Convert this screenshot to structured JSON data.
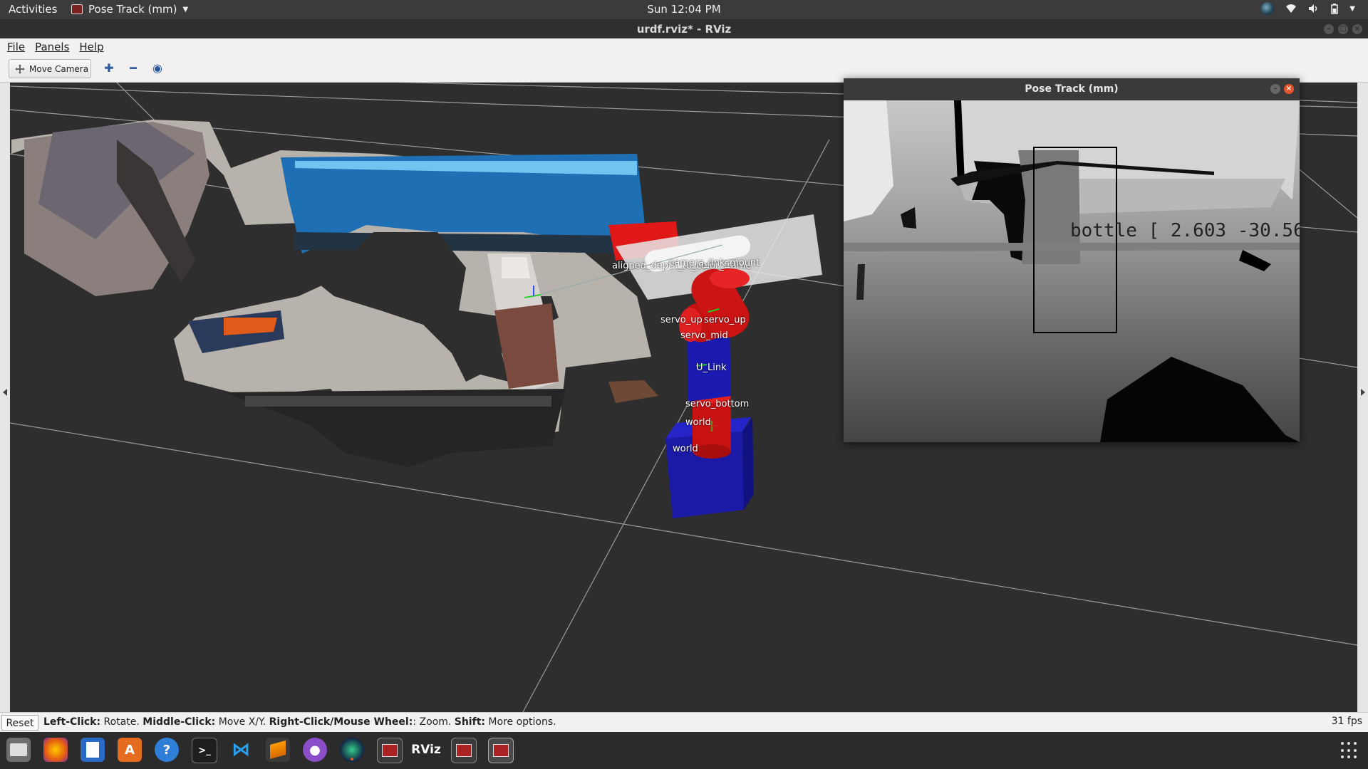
{
  "topbar": {
    "activities": "Activities",
    "app_menu": "Pose Track (mm)",
    "clock": "Sun 12:04 PM"
  },
  "window": {
    "title": "urdf.rviz* - RViz"
  },
  "menubar": {
    "items": [
      "File",
      "Panels",
      "Help"
    ]
  },
  "toolbar": {
    "move_camera": "Move Camera",
    "tools": [
      "interact-plus-icon",
      "zoom-minus-icon",
      "eye-icon"
    ]
  },
  "viewport": {
    "background": "#2e2e2e",
    "link_labels": {
      "camera_mount": "camera_link_mount",
      "depth_frame": "aligned_depth_to_color_frame",
      "servo_up": "servo_up",
      "servo_mid": "servo_mid",
      "u_link": "U_Link",
      "servo_bottom": "servo_bottom",
      "world": "world"
    },
    "colors": {
      "servo": "#cc1414",
      "link": "#1c1cb8"
    }
  },
  "pose_window": {
    "title": "Pose Track (mm)",
    "detection_text": "bottle [    2.603   -30.56"
  },
  "statusbar": {
    "reset": "Reset",
    "help_parts": [
      {
        "b": "Left-Click:",
        "t": " Rotate. "
      },
      {
        "b": "Middle-Click:",
        "t": " Move X/Y. "
      },
      {
        "b": "Right-Click/Mouse Wheel:",
        "t": ": Zoom. "
      },
      {
        "b": "Shift:",
        "t": " More options."
      }
    ],
    "fps": "31 fps"
  },
  "dock": {
    "items": [
      {
        "name": "files-icon",
        "label": ""
      },
      {
        "name": "firefox-icon",
        "label": ""
      },
      {
        "name": "text-editor-icon",
        "label": ""
      },
      {
        "name": "software-center-icon",
        "label": ""
      },
      {
        "name": "help-icon",
        "label": "?"
      },
      {
        "name": "terminal-icon",
        "label": ">_"
      },
      {
        "name": "vscode-icon",
        "label": ""
      },
      {
        "name": "sublime-icon",
        "label": ""
      },
      {
        "name": "github-icon",
        "label": ""
      },
      {
        "name": "camera-app-icon",
        "label": ""
      },
      {
        "name": "rviz-window-icon",
        "label": ""
      },
      {
        "name": "rviz-icon",
        "label": "RViz"
      },
      {
        "name": "rviz-window-icon-2",
        "label": ""
      },
      {
        "name": "rviz-window-icon-3",
        "label": ""
      }
    ]
  }
}
